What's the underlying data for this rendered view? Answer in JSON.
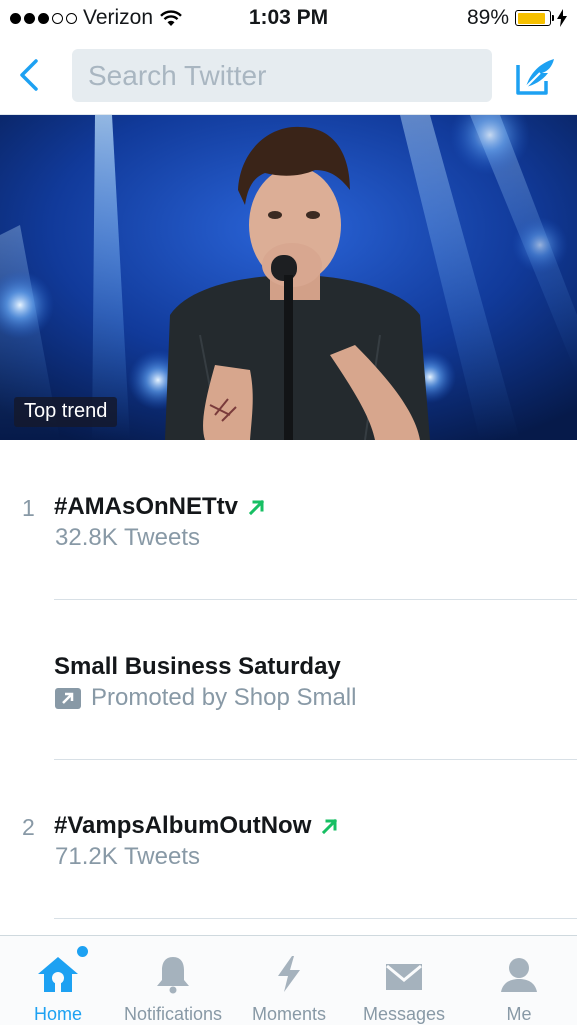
{
  "status_bar": {
    "carrier": "Verizon",
    "time": "1:03 PM",
    "battery_percent": "89%",
    "battery_level": 0.89,
    "signal_bars_filled": 3,
    "signal_bars_total": 5,
    "icons": [
      "wifi-icon",
      "battery-icon",
      "charging-bolt-icon"
    ]
  },
  "header": {
    "search_placeholder": "Search Twitter",
    "back_icon": "chevron-left-icon",
    "compose_icon": "compose-tweet-icon"
  },
  "hero": {
    "badge": "Top trend"
  },
  "trends": [
    {
      "rank": "1",
      "name": "#AMAsOnNETtv",
      "meta": "32.8K Tweets",
      "trending_icon": "trending-arrow-icon"
    },
    {
      "rank": "",
      "name": "Small Business Saturday",
      "meta": "Promoted by Shop Small",
      "promo_icon": "promoted-icon"
    },
    {
      "rank": "2",
      "name": "#VampsAlbumOutNow",
      "meta": "71.2K Tweets",
      "trending_icon": "trending-arrow-icon"
    }
  ],
  "tabs": [
    {
      "label": "Home",
      "icon": "home-icon",
      "active": true
    },
    {
      "label": "Notifications",
      "icon": "bell-icon",
      "active": false
    },
    {
      "label": "Moments",
      "icon": "lightning-icon",
      "active": false
    },
    {
      "label": "Messages",
      "icon": "envelope-icon",
      "active": false
    },
    {
      "label": "Me",
      "icon": "person-icon",
      "active": false
    }
  ],
  "colors": {
    "accent": "#1da1f2",
    "trending_green": "#17bf63",
    "muted_text": "#8899a6",
    "battery_fill": "#f6c000"
  }
}
